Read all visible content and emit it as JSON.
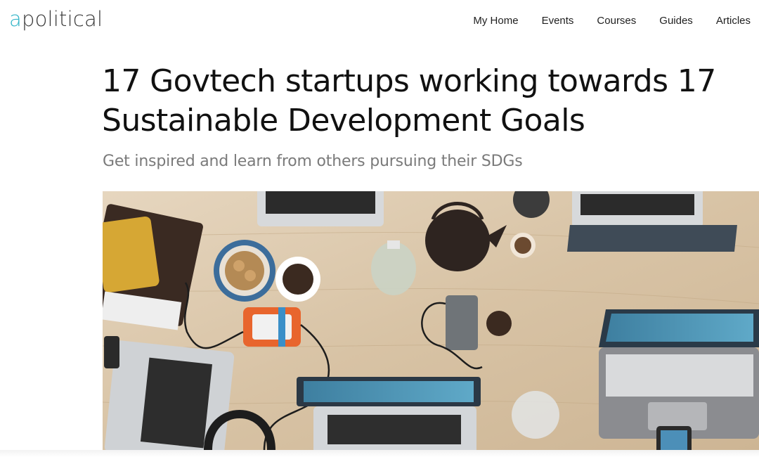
{
  "header": {
    "logo_first_letter": "a",
    "logo_rest": "political",
    "nav": [
      "My Home",
      "Events",
      "Courses",
      "Guides",
      "Articles"
    ]
  },
  "article": {
    "title": "17 Govtech startups working towards 17 Sustainable Development Goals",
    "subtitle": "Get inspired and learn from others pursuing their SDGs"
  },
  "hero": {
    "description_icon": "hero-photo"
  },
  "colors": {
    "brand_accent": "#33b5c8",
    "title": "#111111",
    "subtitle": "#7a7a7a",
    "table_wood": "#d9c7ad"
  }
}
